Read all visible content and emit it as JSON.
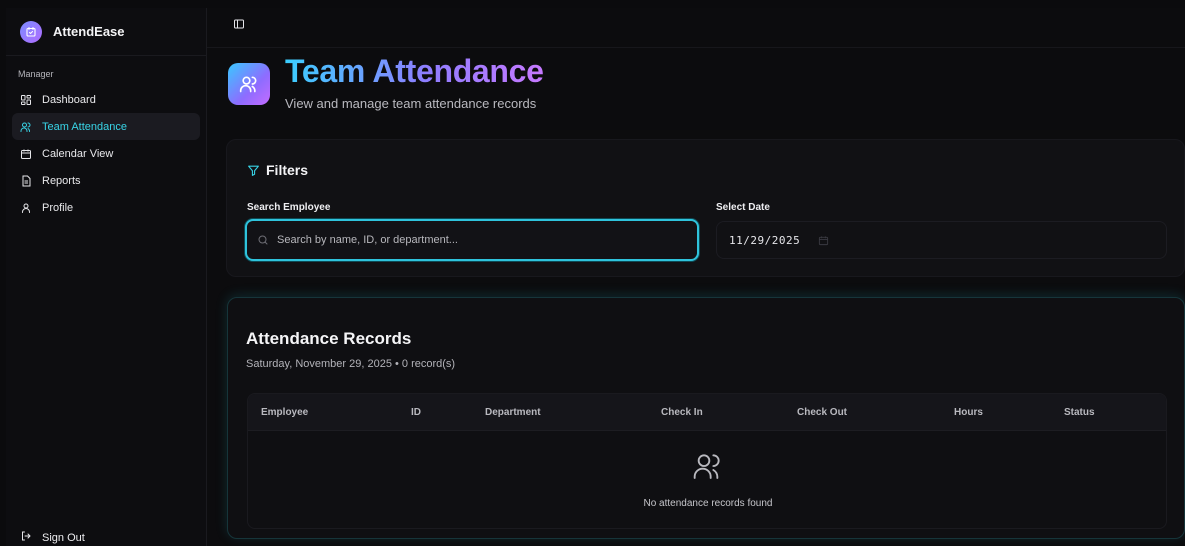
{
  "brand": {
    "name": "AttendEase"
  },
  "sidebar": {
    "section_label": "Manager",
    "items": [
      {
        "label": "Dashboard",
        "icon": "grid-icon",
        "active": false
      },
      {
        "label": "Team Attendance",
        "icon": "users-icon",
        "active": true
      },
      {
        "label": "Calendar View",
        "icon": "calendar-icon",
        "active": false
      },
      {
        "label": "Reports",
        "icon": "file-icon",
        "active": false
      },
      {
        "label": "Profile",
        "icon": "user-icon",
        "active": false
      }
    ],
    "sign_out": "Sign Out"
  },
  "header": {
    "title": "Team Attendance",
    "subtitle": "View and manage team attendance records"
  },
  "filters": {
    "title": "Filters",
    "search_label": "Search Employee",
    "search_placeholder": "Search by name, ID, or department...",
    "date_label": "Select Date",
    "date_value": "11/29/2025"
  },
  "records": {
    "title": "Attendance Records",
    "subtitle": "Saturday, November 29, 2025 • 0 record(s)",
    "columns": [
      "Employee",
      "ID",
      "Department",
      "Check In",
      "Check Out",
      "Hours",
      "Status"
    ],
    "rows": [],
    "empty_text": "No attendance records found"
  },
  "colors": {
    "accent": "#2fc3dc",
    "gradient_start": "#3bcfff",
    "gradient_end": "#c779ff",
    "background": "#0c0c0e"
  }
}
